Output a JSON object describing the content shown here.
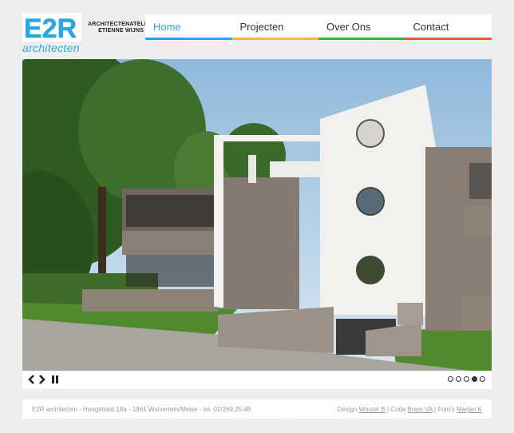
{
  "logo": {
    "mark": "E2R",
    "subtitle": "architecten",
    "tagline_line1": "ARCHITECTENATELIER",
    "tagline_line2": "ETIENNE WIJNS"
  },
  "nav": {
    "items": [
      {
        "label": "Home",
        "color": "#2aa9e0"
      },
      {
        "label": "Projecten",
        "color": "#f6b93b"
      },
      {
        "label": "Over Ons",
        "color": "#3cb043"
      },
      {
        "label": "Contact",
        "color": "#ef5a32"
      }
    ]
  },
  "slider": {
    "icons": {
      "prev": "chevron-left-icon",
      "next": "chevron-right-icon",
      "pause": "pause-icon"
    },
    "slide_count": 5,
    "active_slide": 4
  },
  "footer": {
    "address": "E2R architecten - Hoogstraat 18a - 1861 Wolvertem/Meise - tel. 02/269.25.48",
    "design_prefix": "Design",
    "design_link": "Wouter B",
    "sep1": "|",
    "code_prefix": "Code",
    "code_link": "Bram VA",
    "sep2": "|",
    "photo_prefix": "Foto's",
    "photo_link": "Marjan K"
  }
}
